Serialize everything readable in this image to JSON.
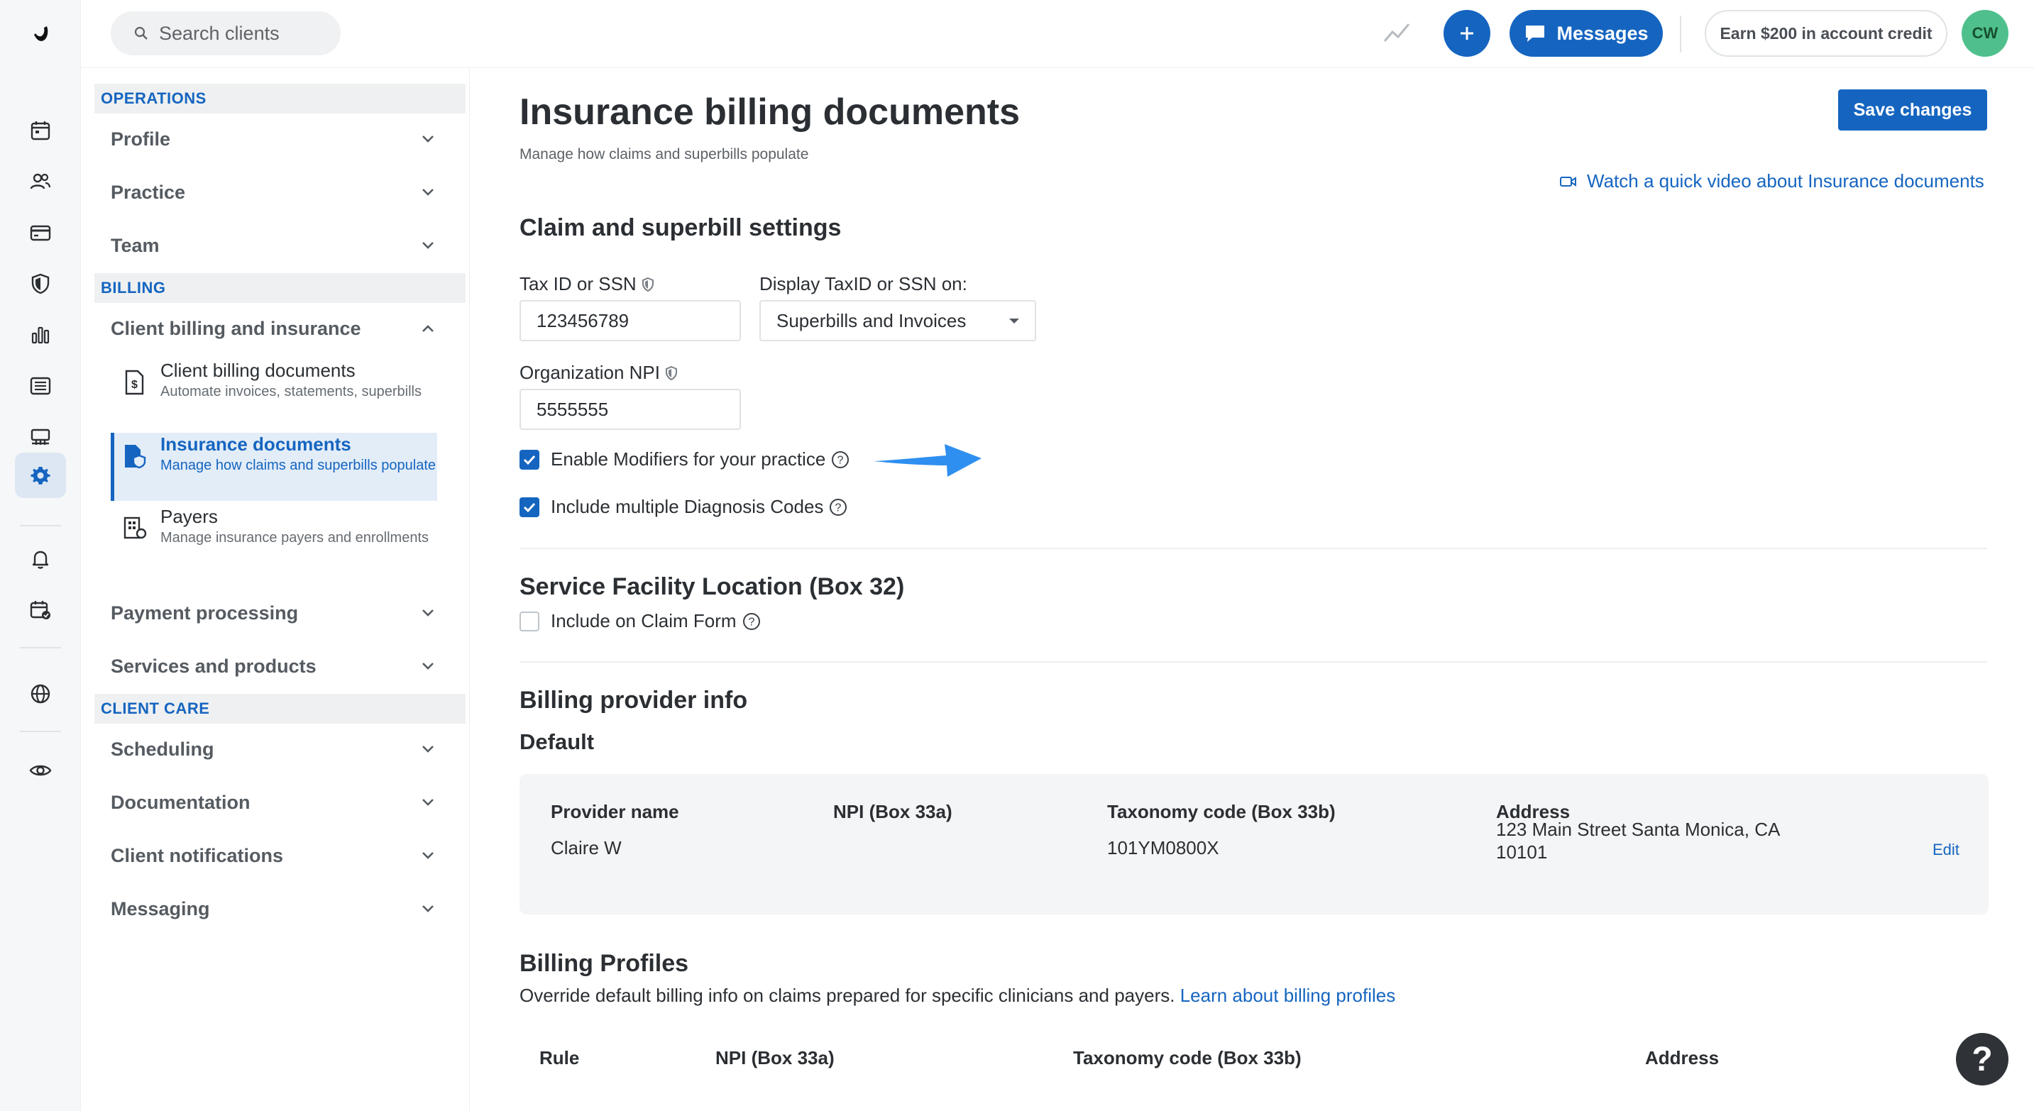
{
  "topbar": {
    "search_placeholder": "Search clients",
    "messages_label": "Messages",
    "earn_label": "Earn $200 in account credit",
    "avatar_initials": "CW"
  },
  "sidebar": {
    "sections": {
      "operations": "OPERATIONS",
      "billing": "BILLING",
      "client_care": "CLIENT CARE"
    },
    "items": {
      "profile": "Profile",
      "practice": "Practice",
      "team": "Team",
      "client_billing_insurance": "Client billing and insurance",
      "payment_processing": "Payment processing",
      "services_products": "Services and products",
      "scheduling": "Scheduling",
      "documentation": "Documentation",
      "client_notifications": "Client notifications",
      "messaging": "Messaging"
    },
    "sub_items": {
      "client_billing_docs_title": "Client billing documents",
      "client_billing_docs_desc": "Automate invoices, statements, superbills",
      "insurance_docs_title": "Insurance documents",
      "insurance_docs_desc": "Manage how claims and superbills populate",
      "payers_title": "Payers",
      "payers_desc": "Manage insurance payers and enrollments"
    }
  },
  "main": {
    "title": "Insurance billing documents",
    "subtitle": "Manage how claims and superbills populate",
    "save_label": "Save changes",
    "video_link": "Watch a quick video about Insurance documents",
    "claim_section": {
      "title": "Claim and superbill settings",
      "tax_id_label": "Tax ID or SSN",
      "tax_id_value": "123456789",
      "display_label": "Display TaxID or SSN on:",
      "display_value": "Superbills and Invoices",
      "npi_label": "Organization NPI",
      "npi_value": "5555555",
      "enable_modifiers_label": "Enable Modifiers for your practice",
      "enable_modifiers_checked": true,
      "multiple_dx_label": "Include multiple Diagnosis Codes",
      "multiple_dx_checked": true
    },
    "facility_section": {
      "title": "Service Facility Location (Box 32)",
      "include_label": "Include on Claim Form",
      "include_checked": false
    },
    "provider_section": {
      "title": "Billing provider info",
      "subtitle": "Default",
      "headers": {
        "name": "Provider name",
        "npi": "NPI (Box 33a)",
        "taxonomy": "Taxonomy code (Box 33b)",
        "address": "Address"
      },
      "row": {
        "name": "Claire W",
        "npi": "",
        "taxonomy": "101YM0800X",
        "address_line1": "123 Main Street Santa Monica, CA",
        "address_line2": "10101"
      },
      "edit_label": "Edit"
    },
    "profiles_section": {
      "title": "Billing Profiles",
      "description": "Override default billing info on claims prepared for specific clinicians and payers.",
      "link": "Learn about billing profiles",
      "headers": {
        "rule": "Rule",
        "npi": "NPI (Box 33a)",
        "taxonomy": "Taxonomy code (Box 33b)",
        "address": "Address"
      }
    }
  },
  "help_label": "?",
  "colors": {
    "accent": "#1565c0",
    "avatar": "#4fc08d",
    "arrow": "#2e8ff0"
  },
  "icons": [
    "logo-icon",
    "calendar-icon",
    "clients-icon",
    "billing-card-icon",
    "insurance-shield-icon",
    "analytics-icon",
    "list-icon",
    "marketplace-icon",
    "settings-gear-icon",
    "bell-icon",
    "calendar-check-icon",
    "globe-icon",
    "eye-icon",
    "search-icon",
    "trend-icon",
    "plus-icon",
    "chat-icon",
    "chevron-down-icon",
    "chevron-up-icon",
    "document-dollar-icon",
    "insurance-doc-icon",
    "payers-icon",
    "info-shield-icon",
    "video-icon",
    "help-circle-icon",
    "checkmark-icon",
    "dropdown-caret-icon"
  ]
}
